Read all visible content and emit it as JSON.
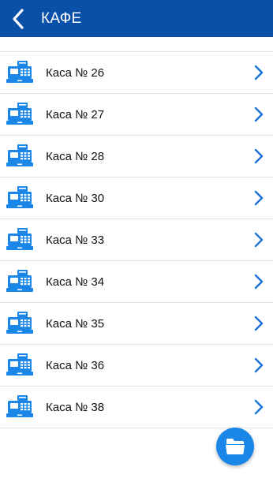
{
  "header": {
    "title": "КАФЕ",
    "back_icon": "chevron-left-icon",
    "background_color": "#0a50a8"
  },
  "list": {
    "items": [
      {
        "label": "Каса № 26",
        "icon": "cash-register-icon",
        "trailing_icon": "chevron-right-icon"
      },
      {
        "label": "Каса № 27",
        "icon": "cash-register-icon",
        "trailing_icon": "chevron-right-icon"
      },
      {
        "label": "Каса № 28",
        "icon": "cash-register-icon",
        "trailing_icon": "chevron-right-icon"
      },
      {
        "label": "Каса № 30",
        "icon": "cash-register-icon",
        "trailing_icon": "chevron-right-icon"
      },
      {
        "label": "Каса № 33",
        "icon": "cash-register-icon",
        "trailing_icon": "chevron-right-icon"
      },
      {
        "label": "Каса № 34",
        "icon": "cash-register-icon",
        "trailing_icon": "chevron-right-icon"
      },
      {
        "label": "Каса № 35",
        "icon": "cash-register-icon",
        "trailing_icon": "chevron-right-icon"
      },
      {
        "label": "Каса № 36",
        "icon": "cash-register-icon",
        "trailing_icon": "chevron-right-icon"
      },
      {
        "label": "Каса № 38",
        "icon": "cash-register-icon",
        "trailing_icon": "chevron-right-icon"
      }
    ]
  },
  "fab": {
    "icon": "folder-icon",
    "color": "#1a87e8"
  },
  "colors": {
    "accent": "#1a87e8",
    "chevron": "#1a73d9"
  }
}
